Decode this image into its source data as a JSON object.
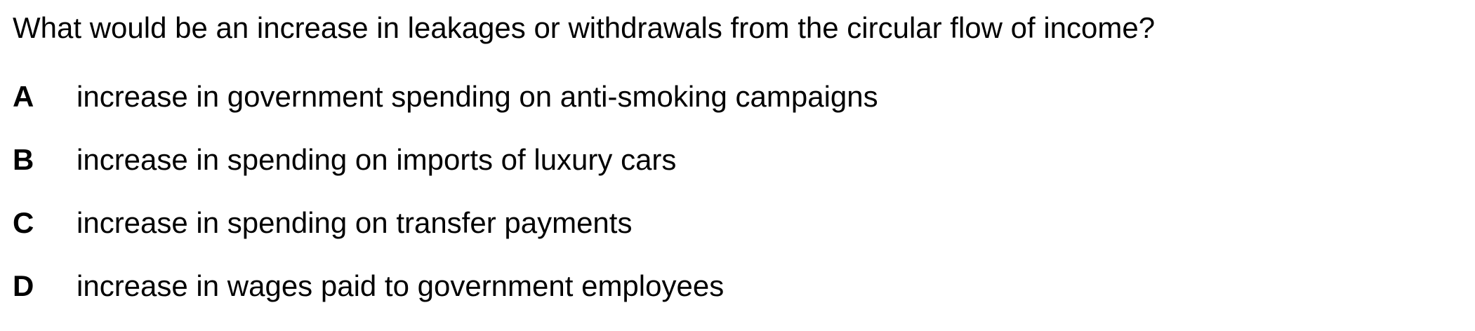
{
  "question": {
    "text": "What would be an increase in leakages or withdrawals from the circular flow of income?"
  },
  "options": [
    {
      "letter": "A",
      "text": "increase in government spending on anti-smoking campaigns"
    },
    {
      "letter": "B",
      "text": "increase in spending on imports of luxury cars"
    },
    {
      "letter": "C",
      "text": "increase in spending on transfer payments"
    },
    {
      "letter": "D",
      "text": "increase in wages paid to government employees"
    }
  ]
}
